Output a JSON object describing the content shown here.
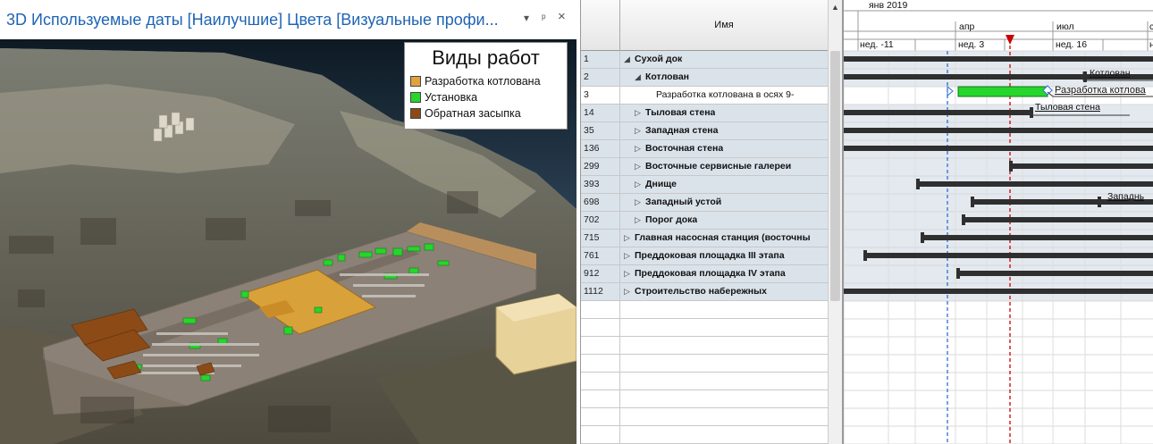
{
  "window": {
    "title": "3D Используемые даты [Наилучшие] Цвета [Визуальные профи...",
    "dropdown_glyph": "▾",
    "pin_glyph": "ᵖ",
    "close_glyph": "×"
  },
  "legend": {
    "title": "Виды работ",
    "items": [
      {
        "label": "Разработка котлована",
        "color": "#e2a13c"
      },
      {
        "label": "Установка",
        "color": "#27d52c"
      },
      {
        "label": "Обратная засыпка",
        "color": "#8b4a16"
      }
    ]
  },
  "grid": {
    "name_header": "Имя",
    "rows": [
      {
        "id": "1",
        "name": "Сухой док",
        "indent": 0,
        "expander": "◢"
      },
      {
        "id": "2",
        "name": "Котлован",
        "indent": 1,
        "expander": "◢"
      },
      {
        "id": "3",
        "name": "Разработка котлована в осях 9-",
        "indent": 3,
        "expander": "",
        "selected": true
      },
      {
        "id": "14",
        "name": "Тыловая стена",
        "indent": 1,
        "expander": "▷"
      },
      {
        "id": "35",
        "name": "Западная стена",
        "indent": 1,
        "expander": "▷"
      },
      {
        "id": "136",
        "name": "Восточная стена",
        "indent": 1,
        "expander": "▷"
      },
      {
        "id": "299",
        "name": "Восточные сервисные галереи",
        "indent": 1,
        "expander": "▷"
      },
      {
        "id": "393",
        "name": "Днище",
        "indent": 1,
        "expander": "▷"
      },
      {
        "id": "698",
        "name": "Западный устой",
        "indent": 1,
        "expander": "▷"
      },
      {
        "id": "702",
        "name": "Порог дока",
        "indent": 1,
        "expander": "▷"
      },
      {
        "id": "715",
        "name": "Главная насосная станция (восточны",
        "indent": 0,
        "expander": "▷"
      },
      {
        "id": "761",
        "name": "Преддоковая площадка III этапа",
        "indent": 0,
        "expander": "▷"
      },
      {
        "id": "912",
        "name": "Преддоковая площадка IV этапа",
        "indent": 0,
        "expander": "▷"
      },
      {
        "id": "1112",
        "name": "Строительство набережных",
        "indent": 0,
        "expander": "▷"
      }
    ]
  },
  "gantt": {
    "timescale_top": [
      "янв 2019"
    ],
    "timescale_mid": [
      "апр",
      "июл",
      "с"
    ],
    "timescale_weeks": [
      "нед. -11",
      "нед. 3",
      "нед. 16",
      "н"
    ],
    "bar_labels": [
      "Котлован",
      "Разработка котлова",
      "Тыловая стена",
      "Западнь"
    ],
    "bar_color_selected": "#27d52c",
    "today_line_color": "#cc0000",
    "status_line_color": "#2b6fd6"
  }
}
